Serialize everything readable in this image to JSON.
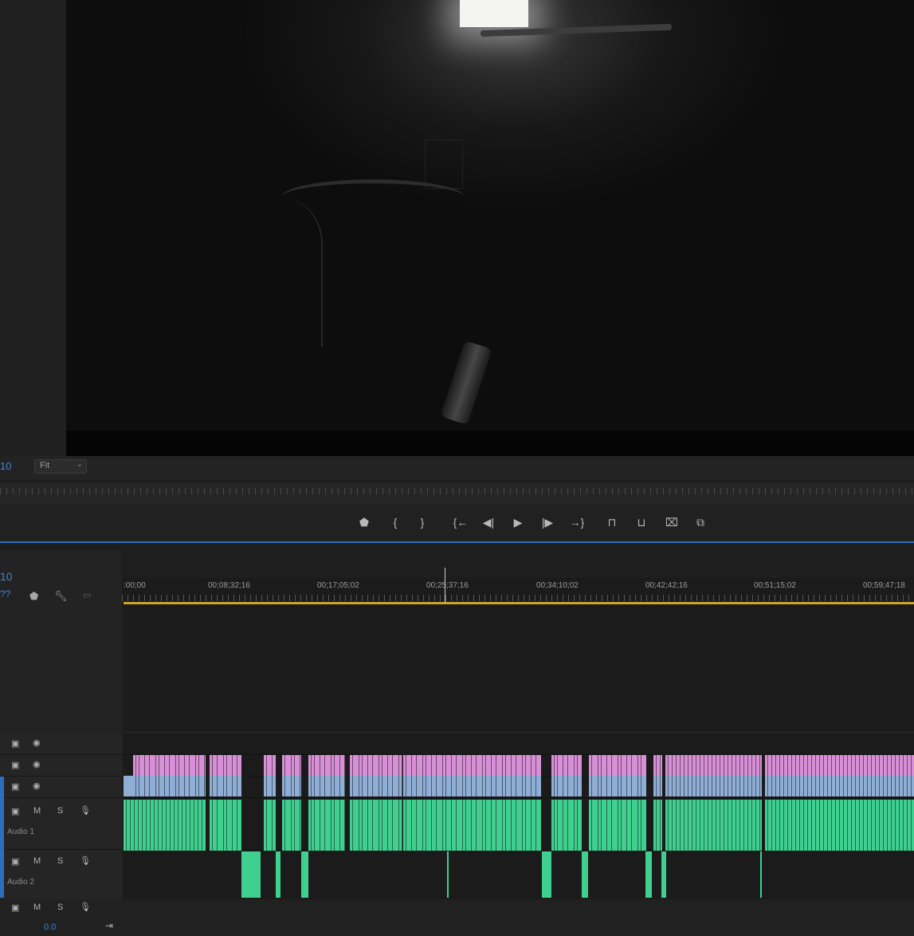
{
  "monitor": {
    "zoom_level": "10",
    "fit_select": "Fit"
  },
  "transport": {
    "buttons": [
      {
        "name": "add-marker-button",
        "glyph": "⬟"
      },
      {
        "name": "mark-in-button",
        "glyph": "{"
      },
      {
        "name": "mark-out-button",
        "glyph": "}"
      },
      {
        "name": "go-to-in-button",
        "glyph": "{←"
      },
      {
        "name": "step-back-button",
        "glyph": "◀|"
      },
      {
        "name": "play-button",
        "glyph": "▶"
      },
      {
        "name": "step-forward-button",
        "glyph": "|▶"
      },
      {
        "name": "go-to-out-button",
        "glyph": "→}"
      },
      {
        "name": "lift-button",
        "glyph": "⊓"
      },
      {
        "name": "extract-button",
        "glyph": "⊔"
      },
      {
        "name": "export-frame-button",
        "glyph": "⌧"
      },
      {
        "name": "comparison-view-button",
        "glyph": "⧉"
      }
    ]
  },
  "timeline": {
    "timecode": "10",
    "timecode_sub": "??",
    "ruler_labels": [
      ":00;00",
      "00;08;32;16",
      "00;17;05;02",
      "00;25;37;16",
      "00;34;10;02",
      "00;42;42;16",
      "00;51;15;02",
      "00;59;47;18"
    ],
    "tracks": {
      "audio1_name": "Audio 1",
      "audio2_name": "Audio 2",
      "mute_label": "M",
      "solo_label": "S"
    },
    "master_value": "0.0"
  },
  "colors": {
    "accent_blue": "#3d85d8",
    "video_clip_pink": "#d78fd6",
    "video_clip_blue": "#8eaed6",
    "audio_clip_green": "#3fcf8f",
    "work_area_yellow": "#c9a627"
  }
}
